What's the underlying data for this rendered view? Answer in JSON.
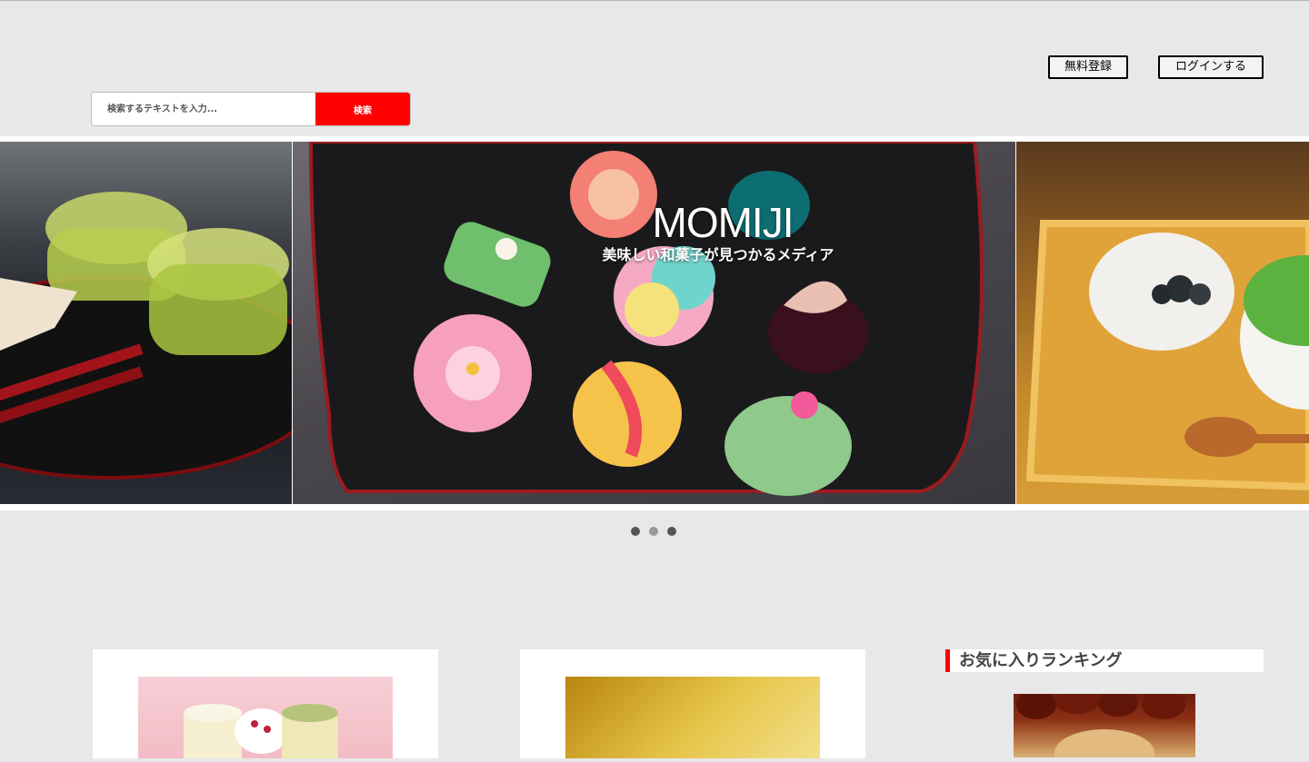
{
  "header": {
    "register_label": "無料登録",
    "login_label": "ログインする"
  },
  "search": {
    "placeholder": "検索するテキストを入力...",
    "button_label": "検索"
  },
  "hero": {
    "title": "MOMIJI",
    "subtitle": "美味しい和菓子が見つかるメディア"
  },
  "slider": {
    "slide_count": 3,
    "active_index": 1
  },
  "sidebar": {
    "ranking_title": "お気に入りランキング"
  },
  "colors": {
    "accent": "#ff0000",
    "page_background": "#e8e8e8"
  }
}
